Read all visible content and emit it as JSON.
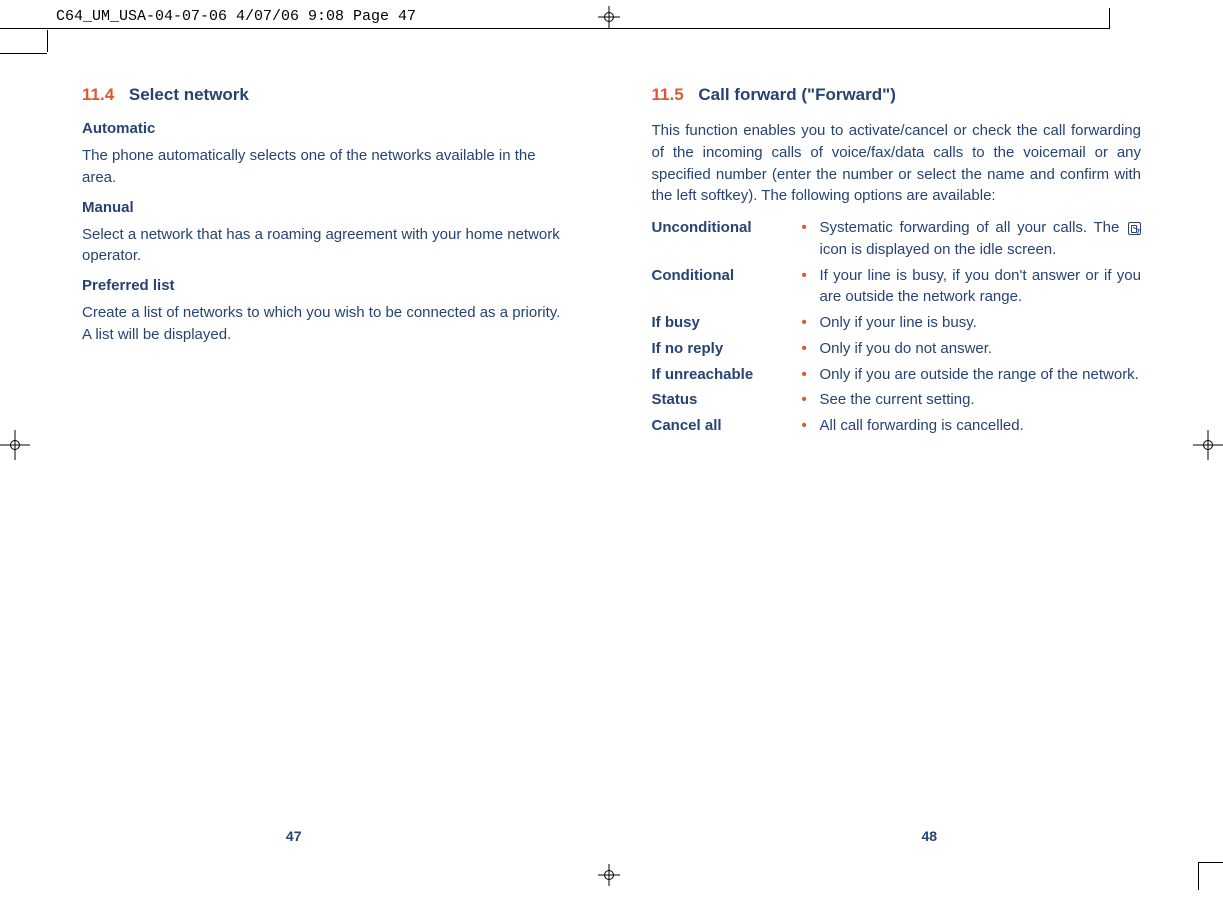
{
  "header": {
    "print_info": "C64_UM_USA-04-07-06  4/07/06  9:08  Page 47"
  },
  "left_page": {
    "section_number": "11.4",
    "section_title": "Select network",
    "sub1_title": "Automatic",
    "sub1_body": "The phone automatically selects one of the networks available in the area.",
    "sub2_title": "Manual",
    "sub2_body": "Select a network that has a roaming agreement with your home network operator.",
    "sub3_title": "Preferred list",
    "sub3_body": "Create a list of networks to which you wish to be connected as a priority. A list will be displayed.",
    "page_number": "47"
  },
  "right_page": {
    "section_number": "11.5",
    "section_title": "Call forward (\"Forward\")",
    "intro": "This function enables you to activate/cancel or check the call forwarding of the incoming calls of voice/fax/data calls to the voicemail or any specified number (enter the number or select the name and confirm with the left softkey). The following options are available:",
    "options": [
      {
        "label": "Unconditional",
        "desc_pre": "Systematic forwarding of all your calls. The ",
        "desc_post": " icon is displayed on the idle screen.",
        "has_icon": true,
        "justify": true
      },
      {
        "label": "Conditional",
        "desc": "If your line is busy, if you don't answer or if you are outside the network range.",
        "justify": true
      },
      {
        "label": "If busy",
        "desc": "Only if your line is busy."
      },
      {
        "label": "If no reply",
        "desc": "Only if you do not answer."
      },
      {
        "label": "If unreachable",
        "desc": "Only if you are outside the range of the network.",
        "justify": true
      },
      {
        "label": "Status",
        "desc": "See the current setting."
      },
      {
        "label": "Cancel all",
        "desc": "All call forwarding is cancelled."
      }
    ],
    "page_number": "48"
  }
}
